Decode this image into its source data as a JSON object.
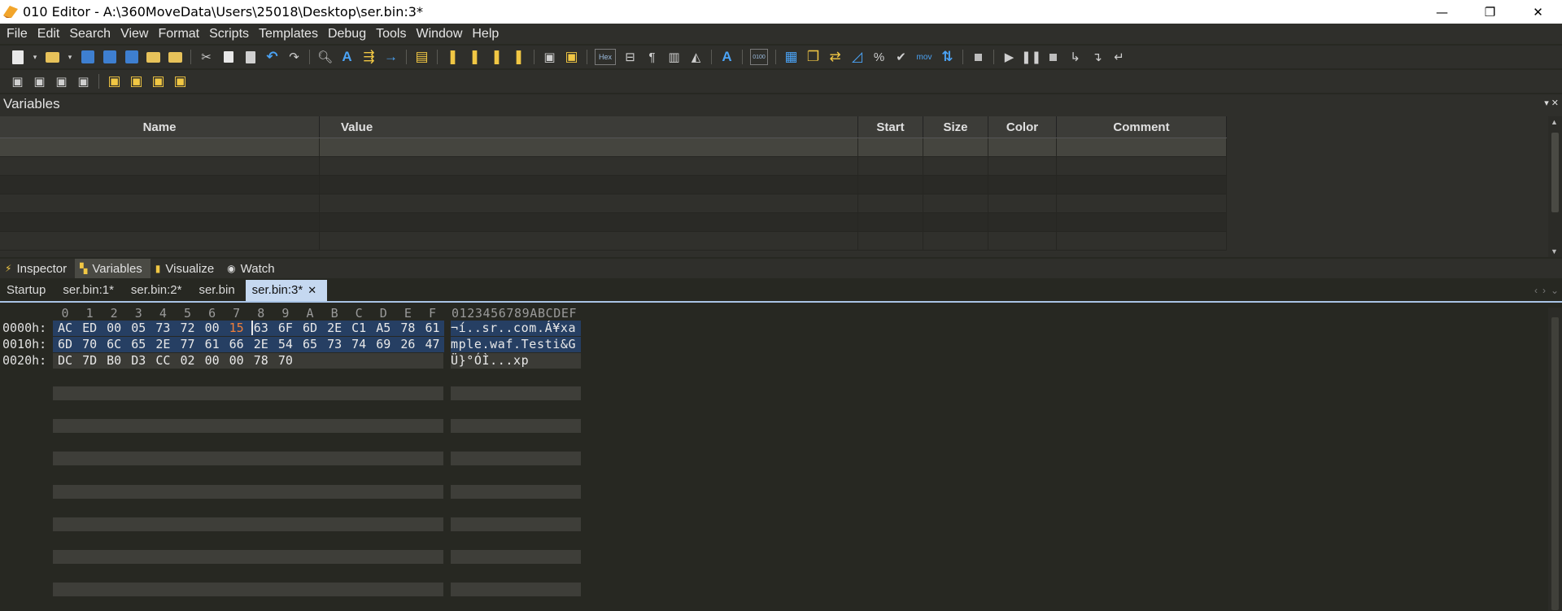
{
  "window": {
    "title": "010 Editor - A:\\360MoveData\\Users\\25018\\Desktop\\ser.bin:3*",
    "minimize": "—",
    "restore": "❐",
    "close": "✕"
  },
  "menu": [
    "File",
    "Edit",
    "Search",
    "View",
    "Format",
    "Scripts",
    "Templates",
    "Debug",
    "Tools",
    "Window",
    "Help"
  ],
  "toolbar": {
    "hex_label": "Hex",
    "mov_label": "mov"
  },
  "variables_panel": {
    "title": "Variables",
    "columns": [
      "Name",
      "Value",
      "Start",
      "Size",
      "Color",
      "Comment"
    ],
    "row_count": 6
  },
  "panel_tabs": [
    {
      "label": "Inspector",
      "icon": "lightning-icon",
      "active": false
    },
    {
      "label": "Variables",
      "icon": "variables-icon",
      "active": true
    },
    {
      "label": "Visualize",
      "icon": "visualize-icon",
      "active": false
    },
    {
      "label": "Watch",
      "icon": "eye-icon",
      "active": false
    }
  ],
  "file_tabs": [
    {
      "label": "Startup",
      "active": false
    },
    {
      "label": "ser.bin:1*",
      "active": false
    },
    {
      "label": "ser.bin:2*",
      "active": false
    },
    {
      "label": "ser.bin",
      "active": false
    },
    {
      "label": "ser.bin:3*",
      "active": true
    }
  ],
  "file_tab_close": "✕",
  "hex": {
    "column_headers": [
      "0",
      "1",
      "2",
      "3",
      "4",
      "5",
      "6",
      "7",
      "8",
      "9",
      "A",
      "B",
      "C",
      "D",
      "E",
      "F"
    ],
    "ascii_header": "0123456789ABCDEF",
    "rows": [
      {
        "addr": "0000h:",
        "bytes": [
          "AC",
          "ED",
          "00",
          "05",
          "73",
          "72",
          "00",
          "15",
          "63",
          "6F",
          "6D",
          "2E",
          "C1",
          "A5",
          "78",
          "61"
        ],
        "ascii": "¬í..sr..com.Á¥xa"
      },
      {
        "addr": "0010h:",
        "bytes": [
          "6D",
          "70",
          "6C",
          "65",
          "2E",
          "77",
          "61",
          "66",
          "2E",
          "54",
          "65",
          "73",
          "74",
          "69",
          "26",
          "47"
        ],
        "ascii": "mple.waf.Testi&G"
      },
      {
        "addr": "0020h:",
        "bytes": [
          "DC",
          "7D",
          "B0",
          "D3",
          "CC",
          "02",
          "00",
          "00",
          "78",
          "70"
        ],
        "ascii": "Ü}°ÓÌ...xp"
      }
    ],
    "highlighted_byte": "15"
  }
}
